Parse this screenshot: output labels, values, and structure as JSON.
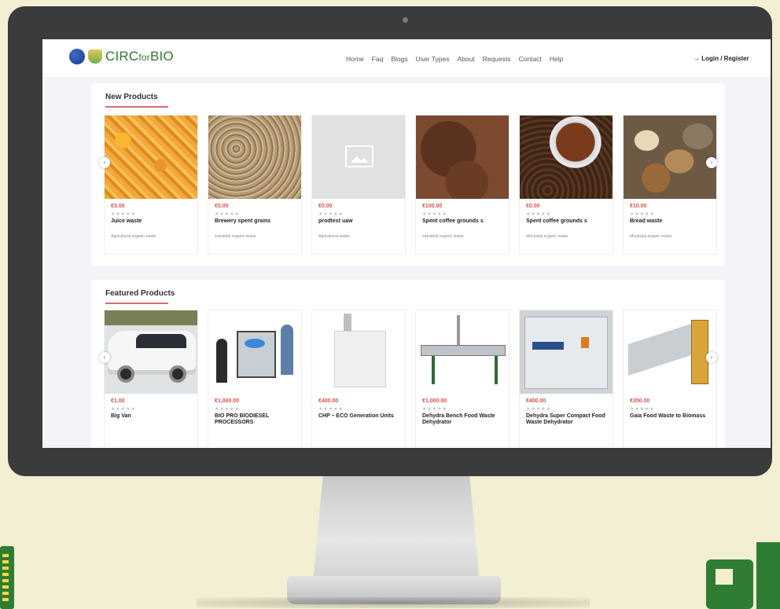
{
  "brand": {
    "name_main": "CIRC",
    "name_small": "for",
    "name_end": "BIO"
  },
  "nav": [
    "Home",
    "Faq",
    "Blogs",
    "User Types",
    "About",
    "Requests",
    "Contact",
    "Help"
  ],
  "login": "→ Login / Register",
  "new_products": {
    "title": "New Products",
    "items": [
      {
        "price": "€3.00",
        "stars": "★★★★★",
        "name": "Juice waste",
        "category": "Agricultural organic waste"
      },
      {
        "price": "€0.00",
        "stars": "★★★★★",
        "name": "Brewery spent grains",
        "category": "Industrial organic waste"
      },
      {
        "price": "€0.00",
        "stars": "★★★★★",
        "name": "prodtest uaw",
        "category": "Agricultural waste"
      },
      {
        "price": "€100.00",
        "stars": "★★★★★",
        "name": "Spent coffee grounds s",
        "category": "Industrial organic waste"
      },
      {
        "price": "€0.00",
        "stars": "★★★★★",
        "name": "Spent coffee grounds s",
        "category": "Municipal organic waste"
      },
      {
        "price": "€10.00",
        "stars": "★★★★★",
        "name": "Bread waste",
        "category": "Municipal organic waste"
      }
    ]
  },
  "featured_products": {
    "title": "Featured Products",
    "items": [
      {
        "price": "€1.00",
        "stars": "★★★★★",
        "name": "Big Van"
      },
      {
        "price": "€1,000.00",
        "stars": "★★★★★",
        "name": "BIO PRO BIODIESEL PROCESSORS"
      },
      {
        "price": "€400.00",
        "stars": "★★★★★",
        "name": "CHP – ECO Generation Units"
      },
      {
        "price": "€1,000.00",
        "stars": "★★★★★",
        "name": "Dehydra Bench Food Waste Dehydrator"
      },
      {
        "price": "€400.00",
        "stars": "★★★★★",
        "name": "Dehydra Super Compact Food Waste Dehydrator"
      },
      {
        "price": "€350.00",
        "stars": "★★★★★",
        "name": "Gaia Food Waste to Biomass"
      }
    ]
  },
  "icons": {
    "prev": "chevron-left-icon",
    "next": "chevron-right-icon"
  },
  "colors": {
    "brand_green": "#2e7d32",
    "price_red": "#d9534f",
    "monitor": "#3a3b3d",
    "background": "#f2efd2"
  }
}
